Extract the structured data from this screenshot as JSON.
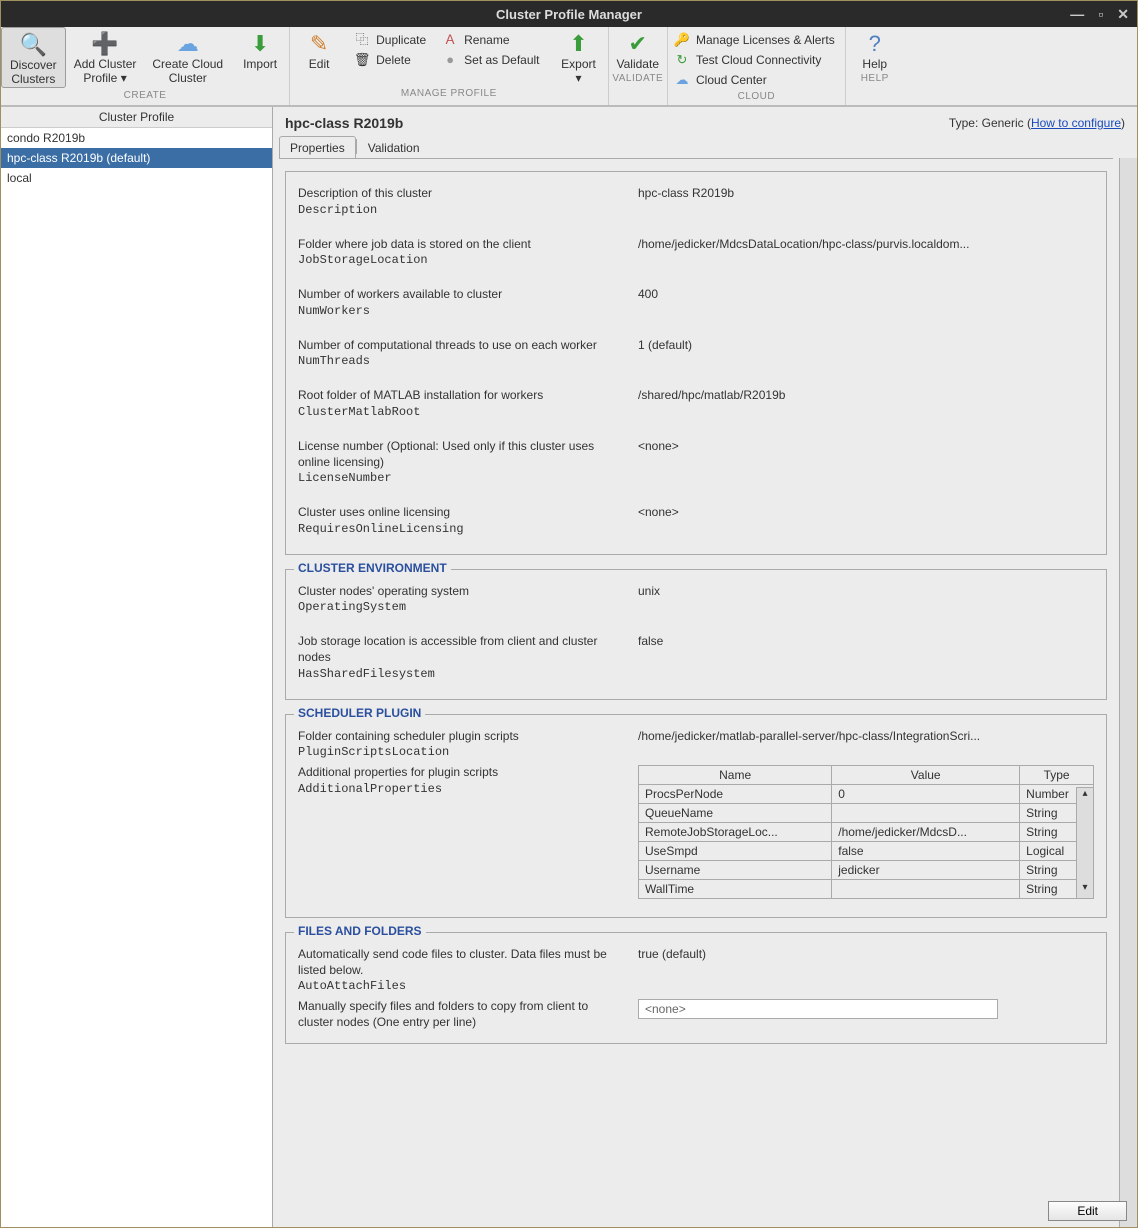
{
  "window": {
    "title": "Cluster Profile Manager"
  },
  "toolbar": {
    "create": {
      "discover": "Discover\nClusters",
      "add": "Add Cluster\nProfile ▾",
      "cloud": "Create Cloud\nCluster",
      "import": "Import",
      "label": "CREATE"
    },
    "manage": {
      "edit": "Edit",
      "duplicate": "Duplicate",
      "rename": "Rename",
      "delete": "Delete",
      "setdefault": "Set as Default",
      "export": "Export\n▾",
      "label": "MANAGE PROFILE"
    },
    "validate": {
      "btn": "Validate",
      "label": "VALIDATE"
    },
    "cloud": {
      "licenses": "Manage Licenses & Alerts",
      "test": "Test Cloud Connectivity",
      "center": "Cloud Center",
      "label": "CLOUD"
    },
    "help": {
      "btn": "Help",
      "label": "HELP"
    }
  },
  "sidebar": {
    "header": "Cluster Profile",
    "items": [
      {
        "label": "condo R2019b"
      },
      {
        "label": "hpc-class R2019b (default)"
      },
      {
        "label": "local"
      }
    ]
  },
  "main": {
    "title": "hpc-class R2019b",
    "type_label": "Type: Generic (",
    "howto": "How to configure",
    "type_close": ")",
    "tabs": {
      "properties": "Properties",
      "validation": "Validation"
    },
    "props": [
      {
        "desc": "Description of this cluster",
        "code": "Description",
        "val": "hpc-class R2019b"
      },
      {
        "desc": "Folder where job data is stored on the client",
        "code": "JobStorageLocation",
        "val": "/home/jedicker/MdcsDataLocation/hpc-class/purvis.localdom..."
      },
      {
        "desc": "Number of workers available to cluster",
        "code": "NumWorkers",
        "val": "400"
      },
      {
        "desc": "Number of computational threads to use on each worker",
        "code": "NumThreads",
        "val": "1 (default)"
      },
      {
        "desc": "Root folder of MATLAB installation for workers",
        "code": "ClusterMatlabRoot",
        "val": "/shared/hpc/matlab/R2019b"
      },
      {
        "desc": "License number (Optional: Used only if this cluster uses online licensing)",
        "code": "LicenseNumber",
        "val": "<none>"
      },
      {
        "desc": "Cluster uses online licensing",
        "code": "RequiresOnlineLicensing",
        "val": "<none>"
      }
    ],
    "env": {
      "legend": "CLUSTER ENVIRONMENT",
      "rows": [
        {
          "desc": "Cluster nodes' operating system",
          "code": "OperatingSystem",
          "val": "unix"
        },
        {
          "desc": "Job storage location is accessible from client and cluster nodes",
          "code": "HasSharedFilesystem",
          "val": "false"
        }
      ]
    },
    "plugin": {
      "legend": "SCHEDULER PLUGIN",
      "rows": [
        {
          "desc": "Folder containing scheduler plugin scripts",
          "code": "PluginScriptsLocation",
          "val": "/home/jedicker/matlab-parallel-server/hpc-class/IntegrationScri..."
        }
      ],
      "additional_desc": "Additional properties for plugin scripts",
      "additional_code": "AdditionalProperties",
      "table_headers": {
        "name": "Name",
        "value": "Value",
        "type": "Type"
      },
      "table_rows": [
        {
          "name": "ProcsPerNode",
          "value": "0",
          "type": "Number"
        },
        {
          "name": "QueueName",
          "value": "",
          "type": "String"
        },
        {
          "name": "RemoteJobStorageLoc...",
          "value": "/home/jedicker/MdcsD...",
          "type": "String"
        },
        {
          "name": "UseSmpd",
          "value": "false",
          "type": "Logical"
        },
        {
          "name": "Username",
          "value": "jedicker",
          "type": "String"
        },
        {
          "name": "WallTime",
          "value": "",
          "type": "String"
        }
      ]
    },
    "files": {
      "legend": "FILES AND FOLDERS",
      "rows": [
        {
          "desc": "Automatically send code files to cluster. Data files must be listed below.",
          "code": "AutoAttachFiles",
          "val": "true (default)"
        }
      ],
      "manual_desc": "Manually specify files and folders to copy from client to cluster nodes (One entry per line)",
      "manual_val": "<none>"
    },
    "edit_btn": "Edit"
  }
}
